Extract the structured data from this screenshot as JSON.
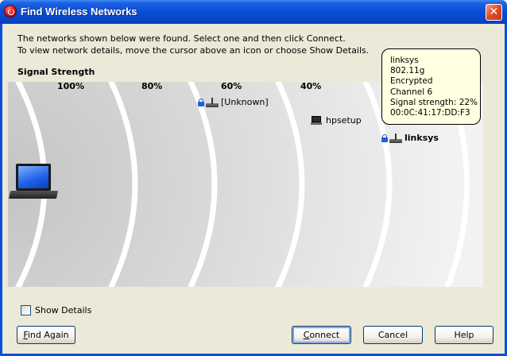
{
  "window": {
    "title": "Find Wireless Networks",
    "close_glyph": "✕"
  },
  "info": {
    "line1": "The networks shown below were found. Select one and then click Connect.",
    "line2": "To view network details, move the cursor above an icon or choose Show Details."
  },
  "signal": {
    "label": "Signal Strength",
    "percents": [
      "100%",
      "80%",
      "60%",
      "40%"
    ]
  },
  "networks": [
    {
      "name": "[Unknown]",
      "encrypted": true,
      "icon": "router-icon"
    },
    {
      "name": "hpsetup",
      "encrypted": false,
      "icon": "computer-icon"
    },
    {
      "name": "linksys",
      "encrypted": true,
      "icon": "router-icon"
    }
  ],
  "tooltip": {
    "lines": [
      "linksys",
      "802.11g",
      "Encrypted",
      "Channel 6",
      "Signal strength: 22%",
      "00:0C:41:17:DD:F3"
    ]
  },
  "show_details": {
    "label": "Show Details",
    "checked": false
  },
  "buttons": {
    "find_again": {
      "prefix": "",
      "mnemonic": "F",
      "rest": "ind Again"
    },
    "connect": {
      "prefix": "",
      "mnemonic": "C",
      "rest": "onnect"
    },
    "cancel": {
      "label": "Cancel"
    },
    "help": {
      "label": "Help"
    }
  },
  "colors": {
    "titlebar": "#0a4fd8",
    "dialog_bg": "#ece9d8",
    "tooltip_bg": "#ffffe1"
  }
}
